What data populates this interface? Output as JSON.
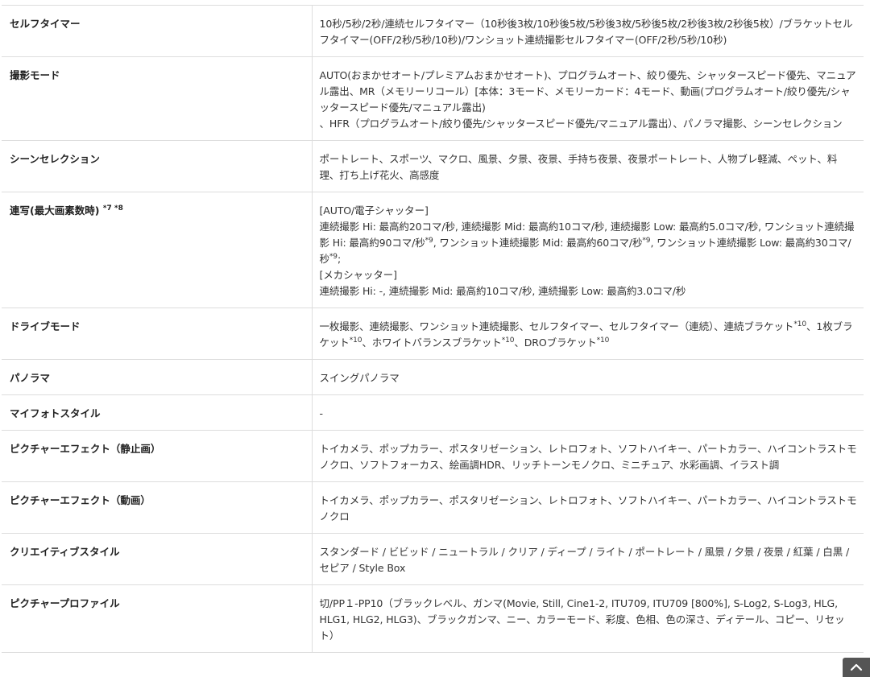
{
  "rows": [
    {
      "label": "セルフタイマー",
      "value": "10秒/5秒/2秒/連続セルフタイマー（10秒後3枚/10秒後5枚/5秒後3枚/5秒後5枚/2秒後3枚/2秒後5枚）/ブラケットセルフタイマー(OFF/2秒/5秒/10秒)/ワンショット連続撮影セルフタイマー(OFF/2秒/5秒/10秒)"
    },
    {
      "label": "撮影モード",
      "value_1": "AUTO(おまかせオート/プレミアムおまかせオート)、プログラムオート、絞り優先、シャッタースピード優先、マニュアル露出、MR（メモリーリコール）[本体：3モード、メモリーカード：4モード、動画(プログラムオート/絞り優先/シャッタースピード優先/マニュアル露出)",
      "value_2": "、HFR（プログラムオート/絞り優先/シャッタースピード優先/マニュアル露出）、パノラマ撮影、シーンセレクション"
    },
    {
      "label": "シーンセレクション",
      "value": "ポートレート、スポーツ、マクロ、風景、夕景、夜景、手持ち夜景、夜景ポートレート、人物ブレ軽減、ペット、料理、打ち上げ花火、高感度"
    },
    {
      "label": "連写(最大画素数時)",
      "label_note": "*7 *8",
      "line_1": "[AUTO/電子シャッター]",
      "line_2a": "連続撮影 Hi: 最高約20コマ/秒, 連続撮影 Mid: 最高約10コマ/秒, 連続撮影 Low: 最高約5.0コマ/秒, ワンショット連続撮影 Hi: 最高約90コマ/秒",
      "note_9a": "*9",
      "line_2b": ", ワンショット連続撮影 Mid: 最高約60コマ/秒",
      "note_9b": "*9",
      "line_2c": ", ワンショット連続撮影 Low: 最高約30コマ/秒",
      "note_9c": "*9",
      "line_2d": ";",
      "line_3": "[メカシャッター]",
      "line_4": "連続撮影 Hi: -, 連続撮影 Mid: 最高約10コマ/秒, 連続撮影 Low: 最高約3.0コマ/秒"
    },
    {
      "label": "ドライブモード",
      "part_1": "一枚撮影、連続撮影、ワンショット連続撮影、セルフタイマー、セルフタイマー（連続）、連続ブラケット",
      "note_1": "*10",
      "part_2": "、1枚ブラケット",
      "note_2": "*10",
      "part_3": "、ホワイトバランスブラケット",
      "note_3": "*10",
      "part_4": "、DROブラケット",
      "note_4": "*10"
    },
    {
      "label": "パノラマ",
      "value": "スイングパノラマ"
    },
    {
      "label": "マイフォトスタイル",
      "value": "-"
    },
    {
      "label": "ピクチャーエフェクト（静止画）",
      "value": "トイカメラ、ポップカラー、ポスタリゼーション、レトロフォト、ソフトハイキー、パートカラー、ハイコントラストモノクロ、ソフトフォーカス、絵画調HDR、リッチトーンモノクロ、ミニチュア、水彩画調、イラスト調"
    },
    {
      "label": "ピクチャーエフェクト（動画）",
      "value": "トイカメラ、ポップカラー、ポスタリゼーション、レトロフォト、ソフトハイキー、パートカラー、ハイコントラストモノクロ"
    },
    {
      "label": "クリエイティブスタイル",
      "value": "スタンダード / ビビッド / ニュートラル / クリア / ディープ / ライト / ポートレート / 風景 / 夕景 / 夜景 / 紅葉 / 白黒 / セピア / Style Box"
    },
    {
      "label": "ピクチャープロファイル",
      "value": "切/PP１-PP10（ブラックレベル、ガンマ(Movie, Still, Cine1-2, ITU709, ITU709 [800%], S-Log2, S-Log3, HLG, HLG1, HLG2, HLG3)、ブラックガンマ、ニー、カラーモード、彩度、色相、色の深さ、ディテール、コピー、リセット）"
    }
  ],
  "colors": {
    "border": "#dddddd",
    "text": "#333333",
    "label_text": "#222222",
    "top_button_bg": "#555555"
  },
  "icons": {
    "top_button": "chevron-up-icon"
  }
}
